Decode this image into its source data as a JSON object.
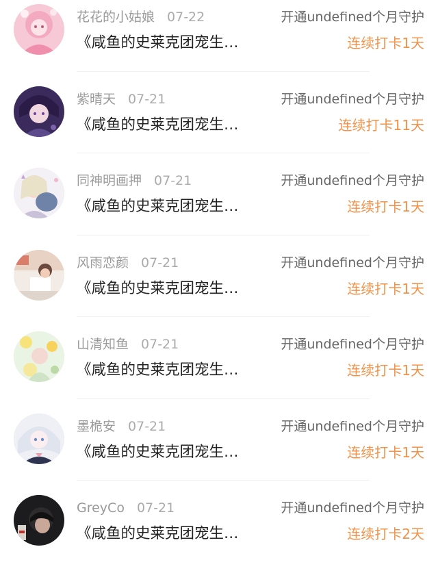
{
  "colors": {
    "name": "#9a9a9a",
    "title": "#222222",
    "action": "#666666",
    "streak": "#f29148"
  },
  "items": [
    {
      "name": "花花的小姑娘",
      "date": "07-22",
      "title": "《咸鱼的史莱克团宠生…",
      "action": "开通undefined个月守护",
      "streak": "连续打卡1天",
      "avatar_icon": "avatar-pink-anime-girl-icon"
    },
    {
      "name": "紫晴天",
      "date": "07-21",
      "title": "《咸鱼的史莱克团宠生…",
      "action": "开通undefined个月守护",
      "streak": "连续打卡11天",
      "avatar_icon": "avatar-purple-anime-boy-icon"
    },
    {
      "name": "同神明画押",
      "date": "07-21",
      "title": "《咸鱼的史莱克团宠生…",
      "action": "开通undefined个月守护",
      "streak": "连续打卡1天",
      "avatar_icon": "avatar-girl-with-plush-icon"
    },
    {
      "name": "风雨恋颜",
      "date": "07-21",
      "title": "《咸鱼的史莱克团宠生…",
      "action": "开通undefined个月守护",
      "streak": "连续打卡1天",
      "avatar_icon": "avatar-photo-room-icon"
    },
    {
      "name": "山清知鱼",
      "date": "07-21",
      "title": "《咸鱼的史莱克团宠生…",
      "action": "开通undefined个月守护",
      "streak": "连续打卡1天",
      "avatar_icon": "avatar-flower-illustration-icon"
    },
    {
      "name": "墨桅安",
      "date": "07-21",
      "title": "《咸鱼的史莱克团宠生…",
      "action": "开通undefined个月守护",
      "streak": "连续打卡1天",
      "avatar_icon": "avatar-white-hair-anime-icon"
    },
    {
      "name": "GreyCo",
      "date": "07-21",
      "title": "《咸鱼的史莱克团宠生…",
      "action": "开通undefined个月守护",
      "streak": "连续打卡2天",
      "avatar_icon": "avatar-dark-photo-icon"
    }
  ]
}
